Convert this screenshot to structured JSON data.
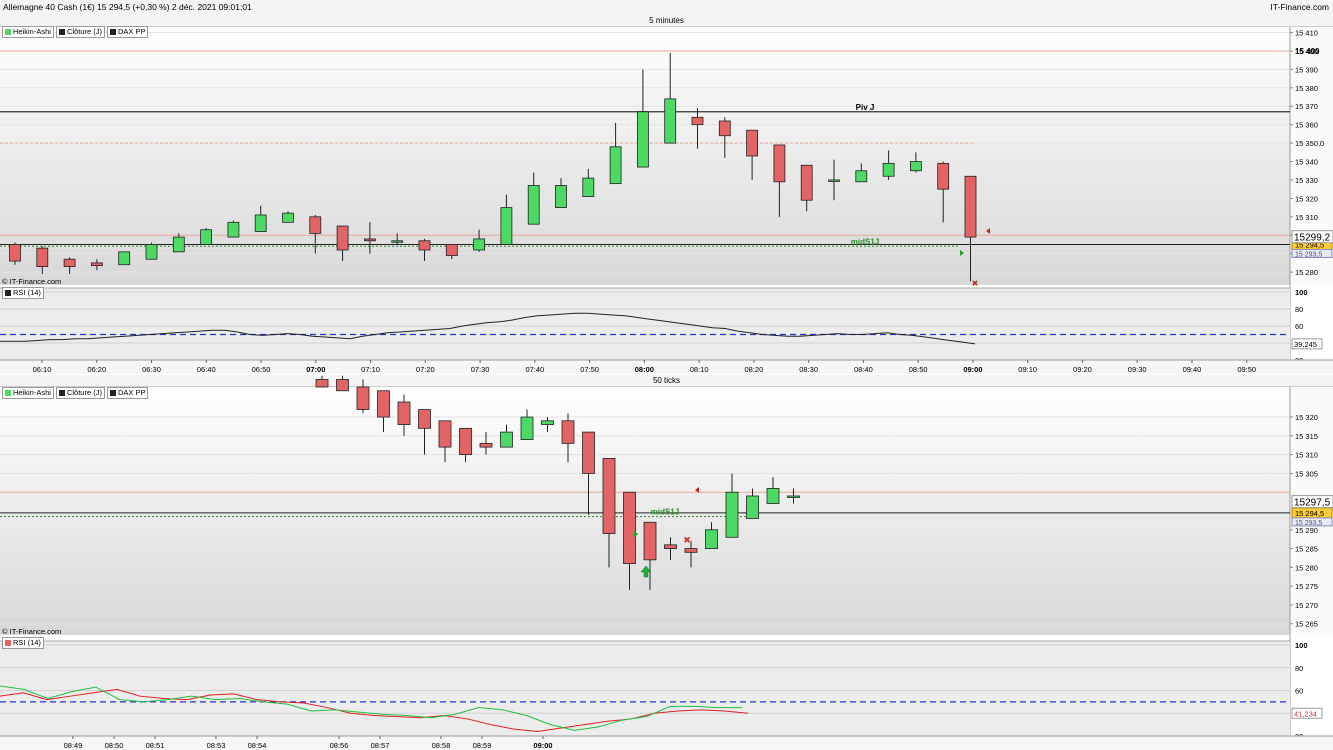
{
  "window": {
    "title": "Allemagne 40 Cash (1€) 15 294,5 (+0,30 %) 2 déc. 2021 09:01:01",
    "brand": "IT-Finance.com"
  },
  "legend": {
    "items": [
      {
        "label": "Heikin-Ashi",
        "color": "#e06666"
      },
      {
        "label": "Clôture (J)",
        "color": "#222222"
      },
      {
        "label": "DAX PP",
        "color": "#222222"
      }
    ],
    "rsi": "RSI (14)",
    "watermark": "© IT-Finance.com"
  },
  "colors": {
    "up": "#4cd964",
    "down": "#e26464",
    "pivot": "#333333",
    "resistance": "#e8a090",
    "support": "#2a8a2a",
    "rsi_mid": "#2030d0"
  },
  "chart_data": [
    {
      "type": "candlestick",
      "title": "5 minutes",
      "ylim": [
        15273,
        15413
      ],
      "y_ticks": [
        "15 410",
        "15 400",
        "15 390",
        "15 380",
        "15 370",
        "15 360",
        "15 350,0",
        "15 340",
        "15 330",
        "15 320",
        "15 310",
        "15 300",
        "15 290",
        "15 280"
      ],
      "y_tick_values": [
        15410,
        15400,
        15390,
        15380,
        15370,
        15360,
        15350,
        15340,
        15330,
        15320,
        15310,
        15300,
        15290,
        15280
      ],
      "x_ticks": [
        "06:10",
        "06:20",
        "06:30",
        "06:40",
        "06:50",
        "07:00",
        "07:10",
        "07:20",
        "07:30",
        "07:40",
        "07:50",
        "08:00",
        "08:10",
        "08:20",
        "08:30",
        "08:40",
        "08:50",
        "09:00",
        "09:10",
        "09:20",
        "09:30",
        "09:40",
        "09:50"
      ],
      "x_bold": [
        "07:00",
        "08:00",
        "09:00"
      ],
      "price_labels": {
        "top": "15 400",
        "current": "15 294,5",
        "bid_small": "15 293,5",
        "half": "15299,2",
        "half_value": 15299.2
      },
      "levels": {
        "piv_j": 15367,
        "r_line": 15400,
        "piv_label": "Piv J",
        "dashed_resistance": 15350,
        "mid_s1": 15294,
        "mid_label": "midS1J",
        "close_line": 15295,
        "upper_band": 15300
      },
      "candles": [
        {
          "t": "06:05",
          "o": 15295,
          "h": 15296,
          "l": 15284,
          "c": 15286
        },
        {
          "t": "06:10",
          "o": 15293,
          "h": 15294,
          "l": 15279,
          "c": 15283
        },
        {
          "t": "06:15",
          "o": 15287,
          "h": 15288,
          "l": 15279,
          "c": 15283
        },
        {
          "t": "06:20",
          "o": 15285,
          "h": 15287,
          "l": 15281,
          "c": 15283.5
        },
        {
          "t": "06:25",
          "o": 15284,
          "h": 15291,
          "l": 15284,
          "c": 15291
        },
        {
          "t": "06:30",
          "o": 15287,
          "h": 15296,
          "l": 15287,
          "c": 15295
        },
        {
          "t": "06:35",
          "o": 15291,
          "h": 15301,
          "l": 15291,
          "c": 15299
        },
        {
          "t": "06:40",
          "o": 15295,
          "h": 15304,
          "l": 15295,
          "c": 15303
        },
        {
          "t": "06:45",
          "o": 15299,
          "h": 15308,
          "l": 15299,
          "c": 15307
        },
        {
          "t": "06:50",
          "o": 15302,
          "h": 15316,
          "l": 15302,
          "c": 15311
        },
        {
          "t": "06:55",
          "o": 15307,
          "h": 15313,
          "l": 15307,
          "c": 15312
        },
        {
          "t": "07:00",
          "o": 15310,
          "h": 15311,
          "l": 15290,
          "c": 15301
        },
        {
          "t": "07:05",
          "o": 15305,
          "h": 15305,
          "l": 15286,
          "c": 15292
        },
        {
          "t": "07:10",
          "o": 15298,
          "h": 15307,
          "l": 15290,
          "c": 15297
        },
        {
          "t": "07:15",
          "o": 15297,
          "h": 15301,
          "l": 15295,
          "c": 15297
        },
        {
          "t": "07:20",
          "o": 15297,
          "h": 15298,
          "l": 15286,
          "c": 15292
        },
        {
          "t": "07:25",
          "o": 15295,
          "h": 15295,
          "l": 15287,
          "c": 15289
        },
        {
          "t": "07:30",
          "o": 15292,
          "h": 15303,
          "l": 15291,
          "c": 15298
        },
        {
          "t": "07:35",
          "o": 15295,
          "h": 15322,
          "l": 15295,
          "c": 15315
        },
        {
          "t": "07:40",
          "o": 15306,
          "h": 15334,
          "l": 15306,
          "c": 15327
        },
        {
          "t": "07:45",
          "o": 15315,
          "h": 15331,
          "l": 15315,
          "c": 15327
        },
        {
          "t": "07:50",
          "o": 15321,
          "h": 15336,
          "l": 15321,
          "c": 15331
        },
        {
          "t": "07:55",
          "o": 15328,
          "h": 15361,
          "l": 15328,
          "c": 15348
        },
        {
          "t": "08:00",
          "o": 15337,
          "h": 15390,
          "l": 15337,
          "c": 15367
        },
        {
          "t": "08:05",
          "o": 15350,
          "h": 15399,
          "l": 15350,
          "c": 15374
        },
        {
          "t": "08:10",
          "o": 15364,
          "h": 15369,
          "l": 15347,
          "c": 15360
        },
        {
          "t": "08:15",
          "o": 15362,
          "h": 15364,
          "l": 15342,
          "c": 15354
        },
        {
          "t": "08:20",
          "o": 15357,
          "h": 15357,
          "l": 15330,
          "c": 15343
        },
        {
          "t": "08:25",
          "o": 15349,
          "h": 15349,
          "l": 15310,
          "c": 15329
        },
        {
          "t": "08:30",
          "o": 15338,
          "h": 15338,
          "l": 15313,
          "c": 15319
        },
        {
          "t": "08:35",
          "o": 15330,
          "h": 15341,
          "l": 15319,
          "c": 15330
        },
        {
          "t": "08:40",
          "o": 15329,
          "h": 15339,
          "l": 15329,
          "c": 15335
        },
        {
          "t": "08:45",
          "o": 15332,
          "h": 15346,
          "l": 15330,
          "c": 15339
        },
        {
          "t": "08:50",
          "o": 15335,
          "h": 15345,
          "l": 15334,
          "c": 15340
        },
        {
          "t": "08:55",
          "o": 15339,
          "h": 15340,
          "l": 15307,
          "c": 15325
        },
        {
          "t": "09:00",
          "o": 15332,
          "h": 15332,
          "l": 15275,
          "c": 15299
        }
      ],
      "rsi": {
        "ylim": [
          20,
          100
        ],
        "ticks": [
          "100",
          "80",
          "60",
          "40",
          "20"
        ],
        "tick_values": [
          100,
          80,
          60,
          40,
          20
        ],
        "level": 50,
        "value_label": "39,245",
        "values": [
          42,
          42,
          42,
          43,
          44,
          44,
          45,
          45,
          46,
          47,
          48,
          49,
          50,
          51,
          52,
          53,
          54,
          55,
          55,
          53,
          50,
          49,
          50,
          51,
          50,
          48,
          47,
          46,
          45,
          48,
          50,
          52,
          53,
          54,
          55,
          56,
          57,
          60,
          62,
          64,
          65,
          67,
          70,
          72,
          73,
          74,
          75,
          75,
          74,
          73,
          72,
          70,
          68,
          66,
          64,
          62,
          60,
          58,
          57,
          54,
          52,
          50,
          49,
          48,
          48,
          49,
          50,
          51,
          50,
          50,
          51,
          52,
          50,
          49,
          47,
          45,
          43,
          41,
          39
        ]
      }
    },
    {
      "type": "candlestick",
      "title": "50 ticks",
      "ylim": [
        15262,
        15328
      ],
      "y_ticks": [
        "15 320",
        "15 315",
        "15 310",
        "15 305",
        "15 290",
        "15 285",
        "15 280",
        "15 275",
        "15 270",
        "15 265"
      ],
      "y_tick_values": [
        15320,
        15315,
        15310,
        15305,
        15290,
        15285,
        15280,
        15275,
        15270,
        15265
      ],
      "x_ticks": [
        "08:49",
        "08:50",
        "08:51",
        "08:53",
        "08:54",
        "08:56",
        "08:57",
        "08:58",
        "08:59",
        "09:00"
      ],
      "x_bold": [
        "09:00"
      ],
      "price_labels": {
        "current": "15 294,5",
        "bid_small": "15 293,5",
        "half": "15297,5",
        "half_value": 15297.5
      },
      "levels": {
        "mid_s1": 15293.5,
        "mid_label": "midS1J",
        "close_line": 15294.5,
        "upper_band": 15300
      },
      "candles": [
        {
          "o": 15330,
          "h": 15331,
          "l": 15328,
          "c": 15328
        },
        {
          "o": 15330,
          "h": 15331,
          "l": 15327,
          "c": 15327
        },
        {
          "o": 15328,
          "h": 15330,
          "l": 15321,
          "c": 15322
        },
        {
          "o": 15327,
          "h": 15327,
          "l": 15316,
          "c": 15320
        },
        {
          "o": 15324,
          "h": 15326,
          "l": 15315,
          "c": 15318
        },
        {
          "o": 15322,
          "h": 15322,
          "l": 15310,
          "c": 15317
        },
        {
          "o": 15319,
          "h": 15319,
          "l": 15308,
          "c": 15312
        },
        {
          "o": 15317,
          "h": 15317,
          "l": 15308,
          "c": 15310
        },
        {
          "o": 15313,
          "h": 15316,
          "l": 15310,
          "c": 15312
        },
        {
          "o": 15312,
          "h": 15318,
          "l": 15312,
          "c": 15316
        },
        {
          "o": 15314,
          "h": 15322,
          "l": 15314,
          "c": 15320
        },
        {
          "o": 15318,
          "h": 15320,
          "l": 15316,
          "c": 15319
        },
        {
          "o": 15319,
          "h": 15321,
          "l": 15308,
          "c": 15313
        },
        {
          "o": 15316,
          "h": 15316,
          "l": 15294,
          "c": 15305
        },
        {
          "o": 15309,
          "h": 15309,
          "l": 15280,
          "c": 15289
        },
        {
          "o": 15300,
          "h": 15300,
          "l": 15274,
          "c": 15281
        },
        {
          "o": 15292,
          "h": 15292,
          "l": 15274,
          "c": 15282
        },
        {
          "o": 15286,
          "h": 15288,
          "l": 15282,
          "c": 15285
        },
        {
          "o": 15285,
          "h": 15287,
          "l": 15280,
          "c": 15284
        },
        {
          "o": 15285,
          "h": 15292,
          "l": 15285,
          "c": 15290
        },
        {
          "o": 15288,
          "h": 15305,
          "l": 15288,
          "c": 15300
        },
        {
          "o": 15293,
          "h": 15301,
          "l": 15293,
          "c": 15299
        },
        {
          "o": 15297,
          "h": 15304,
          "l": 15297,
          "c": 15301
        },
        {
          "o": 15299,
          "h": 15301,
          "l": 15297,
          "c": 15299
        }
      ],
      "rsi": {
        "ylim": [
          20,
          100
        ],
        "ticks": [
          "100",
          "80",
          "60",
          "40",
          "20"
        ],
        "tick_values": [
          100,
          80,
          60,
          40,
          20
        ],
        "level": 50,
        "value_label": "41,234",
        "values_red": [
          55,
          58,
          52,
          55,
          58,
          61,
          55,
          53,
          52,
          56,
          57,
          52,
          50,
          49,
          45,
          40,
          38,
          37,
          36,
          38,
          35,
          30,
          26,
          24,
          27,
          30,
          33,
          35,
          40,
          42,
          43,
          42,
          40
        ],
        "values_green": [
          64,
          61,
          53,
          59,
          63,
          52,
          50,
          52,
          55,
          52,
          53,
          50,
          48,
          42,
          43,
          41,
          39,
          38,
          36,
          39,
          45,
          43,
          38,
          30,
          25,
          28,
          34,
          37,
          46,
          46,
          45,
          45
        ]
      }
    }
  ]
}
